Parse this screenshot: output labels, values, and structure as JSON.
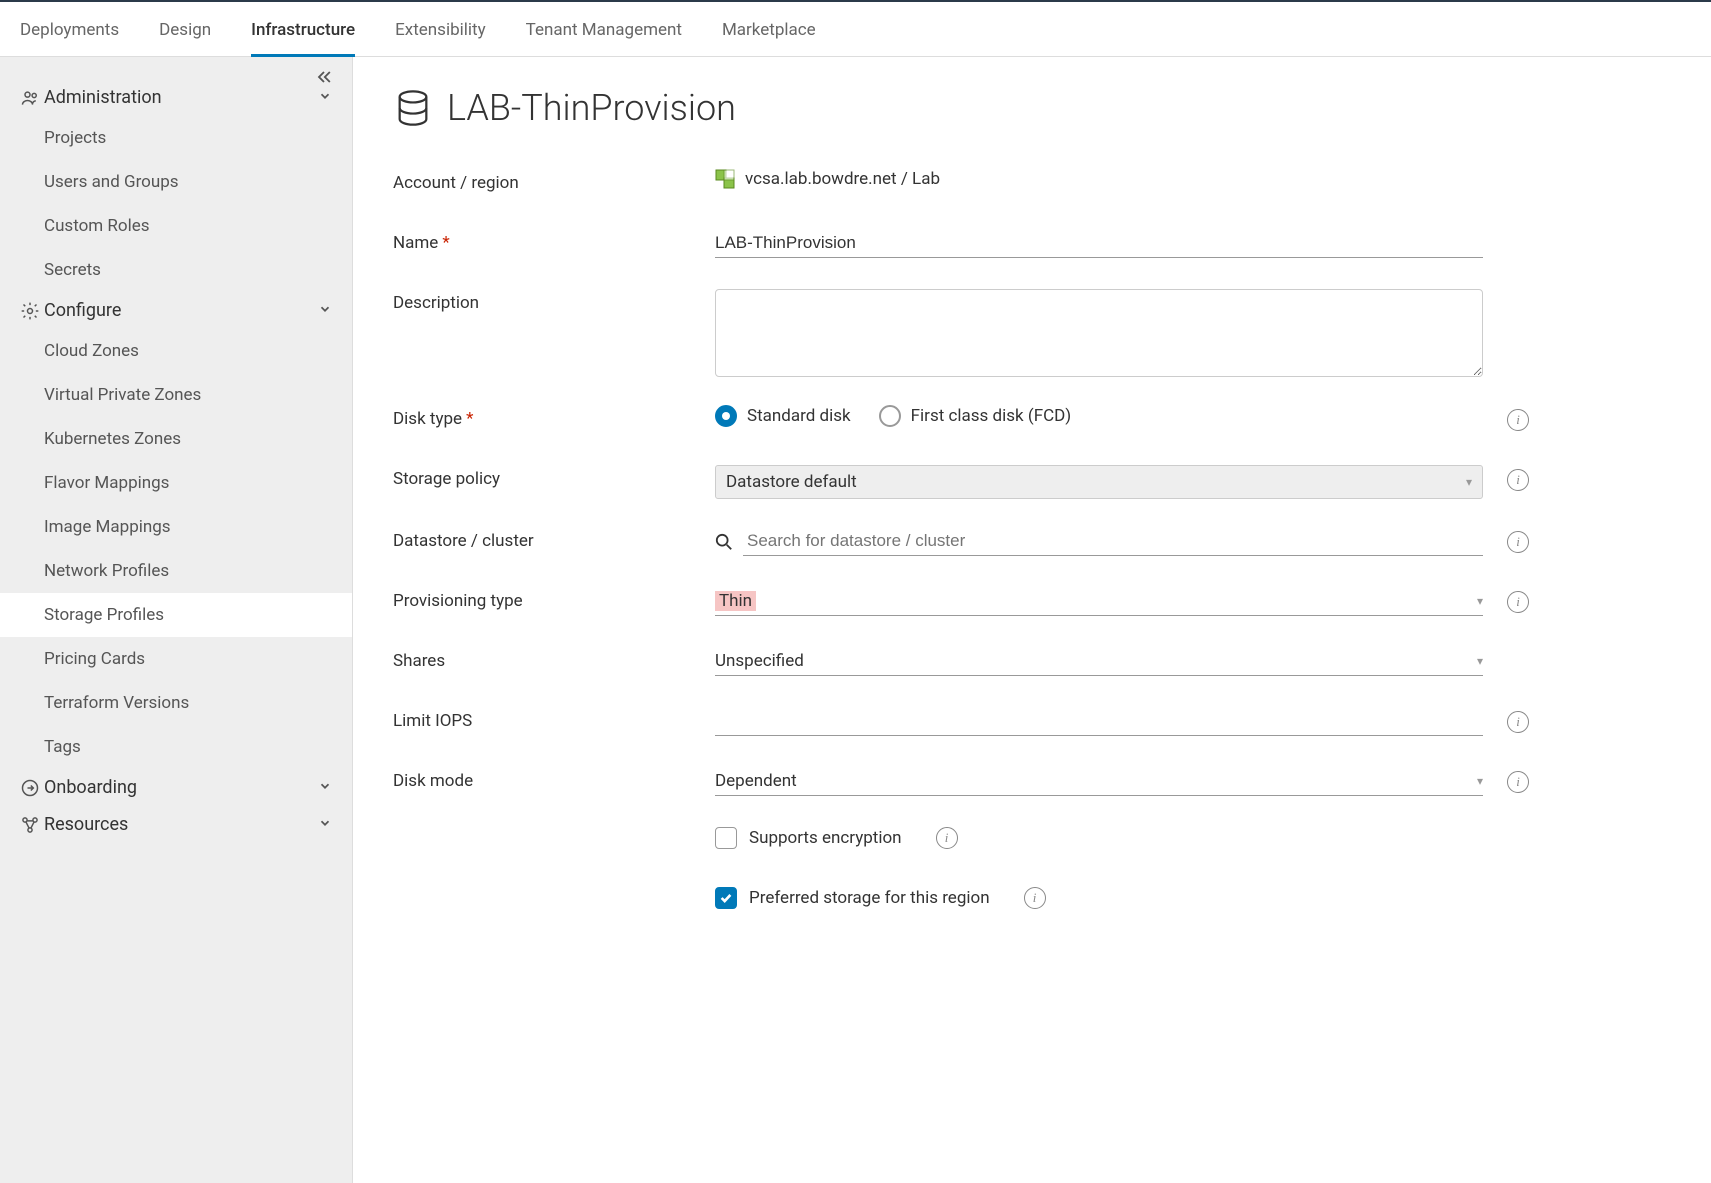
{
  "tabs": [
    "Deployments",
    "Design",
    "Infrastructure",
    "Extensibility",
    "Tenant Management",
    "Marketplace"
  ],
  "active_tab": 2,
  "sidebar": {
    "sections": [
      {
        "title": "Administration",
        "icon": "users",
        "open": true,
        "items": [
          "Projects",
          "Users and Groups",
          "Custom Roles",
          "Secrets"
        ]
      },
      {
        "title": "Configure",
        "icon": "gear",
        "open": true,
        "items": [
          "Cloud Zones",
          "Virtual Private Zones",
          "Kubernetes Zones",
          "Flavor Mappings",
          "Image Mappings",
          "Network Profiles",
          "Storage Profiles",
          "Pricing Cards",
          "Terraform Versions",
          "Tags"
        ],
        "active": 6
      },
      {
        "title": "Onboarding",
        "icon": "circle-arrow",
        "open": false,
        "items": []
      },
      {
        "title": "Resources",
        "icon": "nodes",
        "open": false,
        "items": []
      }
    ]
  },
  "page": {
    "title": "LAB-ThinProvision"
  },
  "form": {
    "account_region_label": "Account / region",
    "account_region_value": "vcsa.lab.bowdre.net / Lab",
    "name_label": "Name",
    "name_value": "LAB-ThinProvision",
    "description_label": "Description",
    "description_value": "",
    "disk_type_label": "Disk type",
    "disk_type_options": [
      "Standard disk",
      "First class disk (FCD)"
    ],
    "disk_type_selected": 0,
    "storage_policy_label": "Storage policy",
    "storage_policy_value": "Datastore default",
    "datastore_label": "Datastore / cluster",
    "datastore_placeholder": "Search for datastore / cluster",
    "prov_type_label": "Provisioning type",
    "prov_type_value": "Thin",
    "shares_label": "Shares",
    "shares_value": "Unspecified",
    "limit_iops_label": "Limit IOPS",
    "limit_iops_value": "",
    "disk_mode_label": "Disk mode",
    "disk_mode_value": "Dependent",
    "supports_encryption_label": "Supports encryption",
    "supports_encryption": false,
    "preferred_storage_label": "Preferred storage for this region",
    "preferred_storage": true
  }
}
